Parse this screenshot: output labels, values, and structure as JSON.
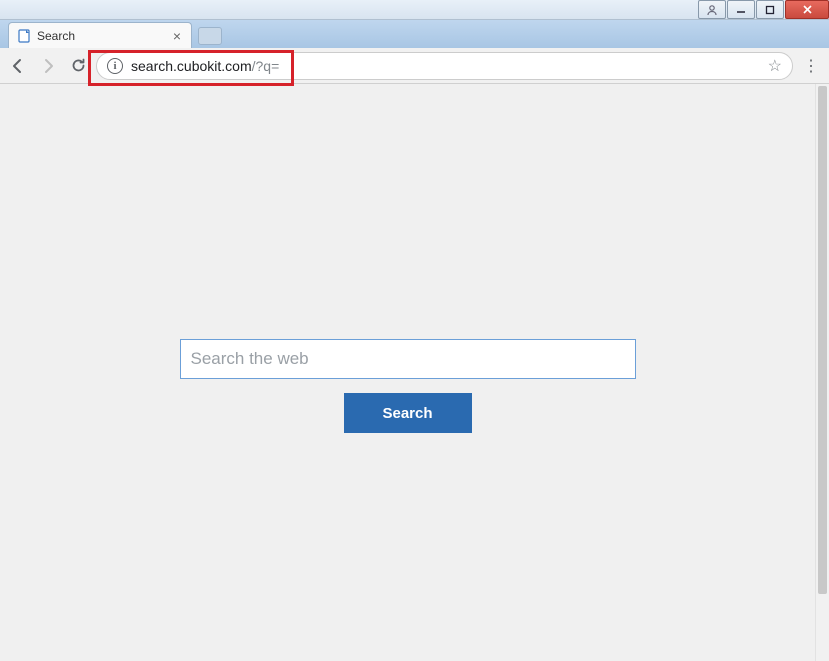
{
  "window": {
    "user_btn": "◦",
    "min_label": "—",
    "max_label": "❐",
    "close_label": "✕"
  },
  "tab": {
    "title": "Search",
    "close": "×"
  },
  "nav": {
    "back": "←",
    "forward": "→",
    "reload": "↻"
  },
  "omnibox": {
    "info": "i",
    "url_main": "search.cubokit.com",
    "url_query": "/?q=",
    "star": "☆"
  },
  "menu": {
    "dots": "⋮"
  },
  "page": {
    "search_placeholder": "Search the web",
    "search_value": "",
    "search_button": "Search"
  }
}
